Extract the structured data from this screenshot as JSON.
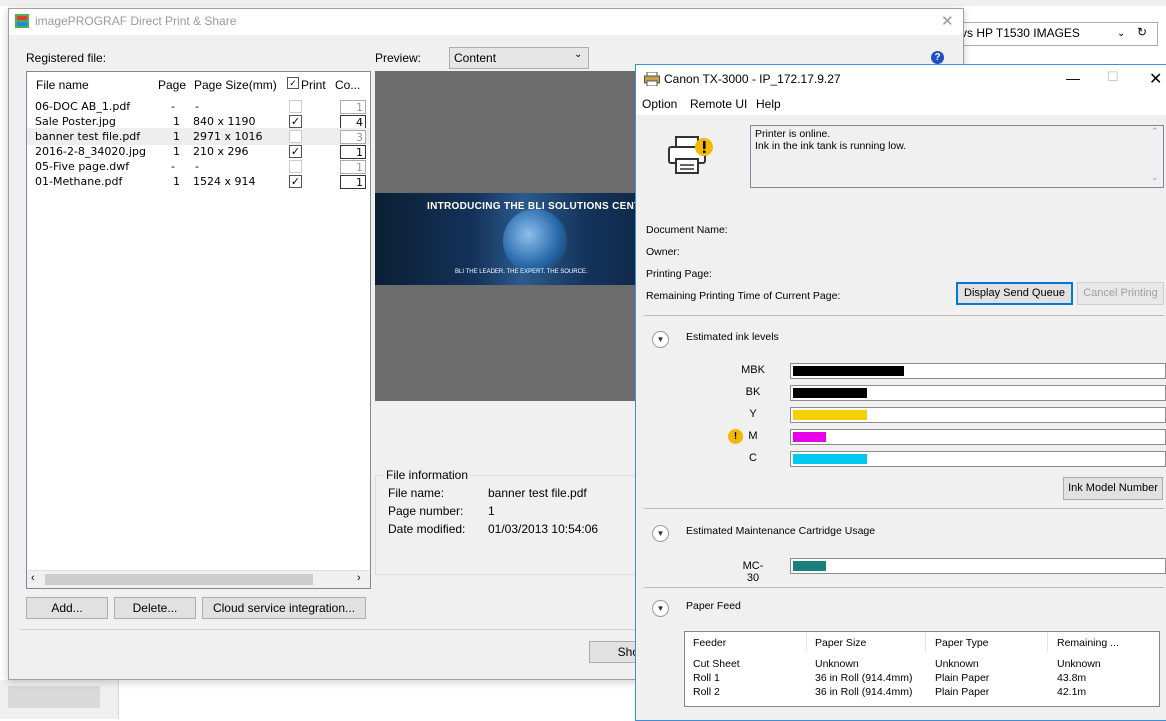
{
  "background_window": {
    "combo_text": "vs HP T1530 IMAGES"
  },
  "direct_print": {
    "title": "imagePROGRAF Direct Print & Share",
    "registered_label": "Registered file:",
    "columns": [
      "File name",
      "Page",
      "Page Size(mm)",
      "Print",
      "Co..."
    ],
    "files": [
      {
        "name": "06-DOC AB_1.pdf",
        "page": "-",
        "size": "-",
        "print": false,
        "print_enabled": false,
        "count": "1",
        "count_active": false
      },
      {
        "name": "Sale Poster.jpg",
        "page": "1",
        "size": "840 x 1190",
        "print": true,
        "print_enabled": true,
        "count": "4",
        "count_active": true
      },
      {
        "name": "banner test file.pdf",
        "page": "1",
        "size": "2971 x 1016",
        "print": false,
        "print_enabled": false,
        "count": "3",
        "count_active": false
      },
      {
        "name": "2016-2-8_34020.jpg",
        "page": "1",
        "size": "210 x 296",
        "print": true,
        "print_enabled": true,
        "count": "1",
        "count_active": true
      },
      {
        "name": "05-Five page.dwf",
        "page": "-",
        "size": "-",
        "print": false,
        "print_enabled": false,
        "count": "1",
        "count_active": false
      },
      {
        "name": "01-Methane.pdf",
        "page": "1",
        "size": "1524 x 914",
        "print": true,
        "print_enabled": true,
        "count": "1",
        "count_active": true
      }
    ],
    "preview_label": "Preview:",
    "preview_value": "Content",
    "banner_title": "INTRODUCING THE BLI SOLUTIONS CENTER",
    "banner_footer": "BLI  THE LEADER. THE EXPERT. THE SOURCE.",
    "file_info": {
      "title": "File information",
      "name_label": "File name:",
      "name_value": "banner test file.pdf",
      "page_label": "Page number:",
      "page_value": "1",
      "date_label": "Date modified:",
      "date_value": "01/03/2013 10:54:06"
    },
    "buttons": {
      "add": "Add...",
      "delete": "Delete...",
      "cloud": "Cloud service integration...",
      "shortcut": "Shortcut"
    }
  },
  "canon": {
    "title": "Canon TX-3000 - IP_172.17.9.27",
    "menu": [
      "Option",
      "Remote UI",
      "Help"
    ],
    "status_lines": [
      "Printer is online.",
      "Ink in the ink tank is running low."
    ],
    "document_name_label": "Document Name:",
    "owner_label": "Owner:",
    "printing_page_label": "Printing Page:",
    "remaining_time_label": "Remaining Printing Time of Current Page:",
    "display_queue_button": "Display Send Queue",
    "cancel_printing_button": "Cancel Printing",
    "ink_section_title": "Estimated ink levels",
    "inks": [
      {
        "name": "MBK",
        "level": 0.3,
        "color": "#000000",
        "warning": false
      },
      {
        "name": "BK",
        "level": 0.2,
        "color": "#000000",
        "warning": false
      },
      {
        "name": "Y",
        "level": 0.2,
        "color": "#f5d000",
        "warning": false
      },
      {
        "name": "M",
        "level": 0.09,
        "color": "#e800e8",
        "warning": true
      },
      {
        "name": "C",
        "level": 0.2,
        "color": "#00c8f0",
        "warning": false
      }
    ],
    "ink_model_button": "Ink Model Number",
    "maintenance_section_title": "Estimated Maintenance Cartridge Usage",
    "maintenance": {
      "name": "MC-30",
      "level": 0.09,
      "color": "#1a7f7f"
    },
    "paper_section_title": "Paper Feed",
    "paper_columns": [
      "Feeder",
      "Paper Size",
      "Paper Type",
      "Remaining ..."
    ],
    "paper_rows": [
      [
        "Cut Sheet",
        "Unknown",
        "Unknown",
        "Unknown"
      ],
      [
        "Roll 1",
        "36 in Roll (914.4mm)",
        "Plain Paper",
        "43.8m"
      ],
      [
        "Roll 2",
        "36 in Roll (914.4mm)",
        "Plain Paper",
        "42.1m"
      ]
    ]
  }
}
